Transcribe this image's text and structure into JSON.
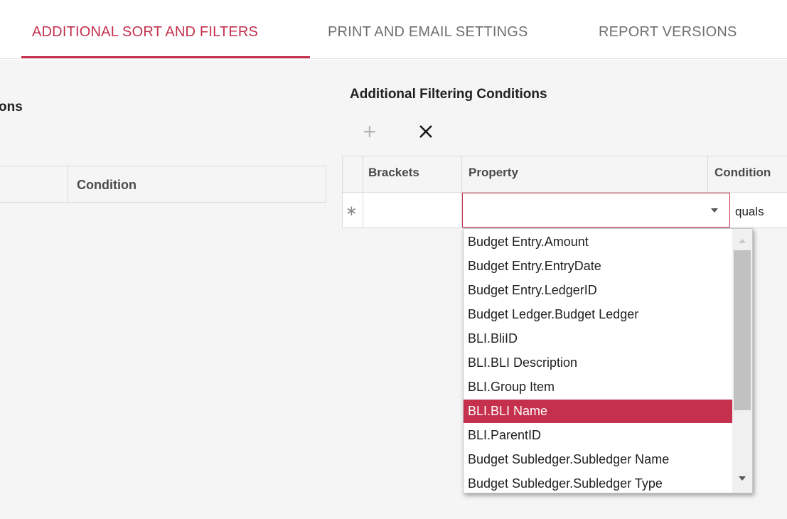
{
  "tabs": [
    {
      "label": "ADDITIONAL SORT AND FILTERS",
      "active": true
    },
    {
      "label": "PRINT AND EMAIL SETTINGS",
      "active": false
    },
    {
      "label": "REPORT VERSIONS",
      "active": false
    }
  ],
  "left_panel": {
    "title_fragment": "ons",
    "column_header": "Condition"
  },
  "filtering": {
    "title": "Additional Filtering Conditions",
    "toolbar": {
      "add_icon": "plus-icon",
      "remove_icon": "close-icon"
    },
    "columns": [
      "Brackets",
      "Property",
      "Condition"
    ],
    "new_row_marker": "∗",
    "property_value": "",
    "condition_value_fragment": "quals"
  },
  "property_dropdown": {
    "options": [
      "Budget Entry.Amount",
      "Budget Entry.EntryDate",
      "Budget Entry.LedgerID",
      "Budget Ledger.Budget Ledger",
      "BLI.BliID",
      "BLI.BLI Description",
      "BLI.Group Item",
      "BLI.BLI Name",
      "BLI.ParentID",
      "Budget Subledger.Subledger Name",
      "Budget Subledger.Subledger Type"
    ],
    "selected": "BLI.BLI Name"
  },
  "colors": {
    "accent": "#c5304d",
    "tab_inactive": "#707070",
    "background": "#f5f5f5",
    "border": "#d9d9d9"
  }
}
